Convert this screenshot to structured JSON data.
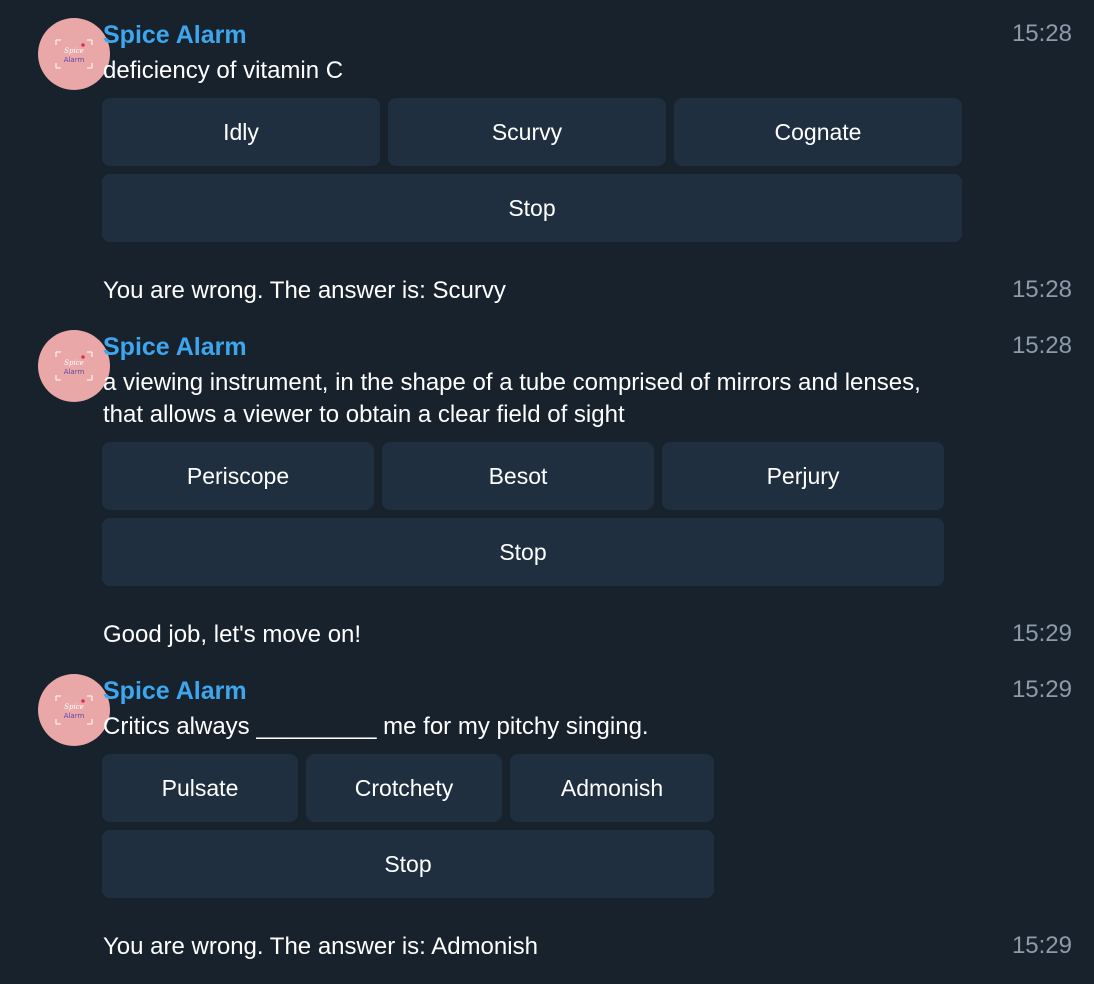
{
  "messages": [
    {
      "sender": "Spice Alarm",
      "avatar_text": [
        "Spice",
        "Alarm"
      ],
      "text": "deficiency of vitamin C",
      "time": "15:28",
      "buttons": [
        "Idly",
        "Scurvy",
        "Cognate"
      ],
      "stop": "Stop",
      "reply": "You are wrong. The answer is: Scurvy",
      "reply_time": "15:28"
    },
    {
      "sender": "Spice Alarm",
      "avatar_text": [
        "Spice",
        "Alarm"
      ],
      "text": "a viewing instrument, in the shape of a tube comprised of mirrors and lenses, that allows a viewer to obtain a clear field of sight",
      "time": "15:28",
      "buttons": [
        "Periscope",
        "Besot",
        "Perjury"
      ],
      "stop": "Stop",
      "reply": "Good job, let's move on!",
      "reply_time": "15:29"
    },
    {
      "sender": "Spice Alarm",
      "avatar_text": [
        "Spice",
        "Alarm"
      ],
      "text": "Critics always _________ me for my pitchy singing.",
      "time": "15:29",
      "buttons": [
        "Pulsate",
        "Crotchety",
        "Admonish"
      ],
      "stop": "Stop",
      "reply": "You are wrong. The answer is: Admonish",
      "reply_time": "15:29"
    }
  ],
  "colors": {
    "background": "#18222d",
    "sender_name": "#3ea6ee",
    "button_bg": "#202f40",
    "timestamp": "#8c9aa9",
    "avatar_bg": "#e9a7a7"
  },
  "icons": {
    "avatar": "spice-alarm-logo-icon"
  }
}
